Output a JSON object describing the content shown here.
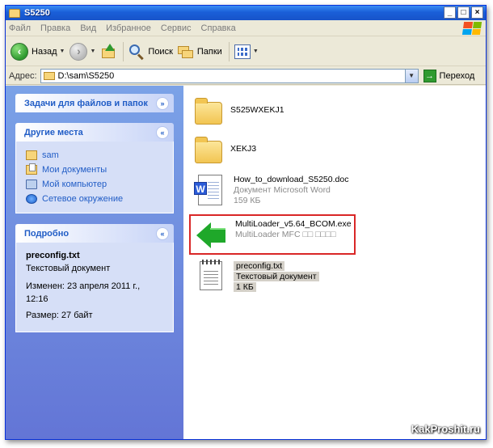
{
  "window": {
    "title": "S5250"
  },
  "menu": [
    "Файл",
    "Правка",
    "Вид",
    "Избранное",
    "Сервис",
    "Справка"
  ],
  "toolbar": {
    "back_label": "Назад",
    "search_label": "Поиск",
    "folders_label": "Папки"
  },
  "address": {
    "label": "Адрес:",
    "path": "D:\\sam\\S5250",
    "go_label": "Переход"
  },
  "tasks": {
    "file_tasks_title": "Задачи для файлов и папок",
    "other_places_title": "Другие места",
    "other_places": [
      {
        "label": "sam",
        "icon": "folder-icon"
      },
      {
        "label": "Мои документы",
        "icon": "my-documents-icon"
      },
      {
        "label": "Мой компьютер",
        "icon": "my-computer-icon"
      },
      {
        "label": "Сетевое окружение",
        "icon": "network-icon"
      }
    ],
    "details_title": "Подробно",
    "details": {
      "name": "preconfig.txt",
      "type": "Текстовый документ",
      "modified": "Изменен: 23 апреля 2011 г., 12:16",
      "size": "Размер: 27 байт"
    }
  },
  "files": [
    {
      "name": "S525WXEKJ1",
      "icon": "folder-icon"
    },
    {
      "name": "XEKJ3",
      "icon": "folder-icon"
    },
    {
      "name": "How_to_download_S5250.doc",
      "type": "Документ Microsoft Word",
      "size": "159 КБ",
      "icon": "word-document-icon"
    },
    {
      "name": "MultiLoader_v5.64_BCOM.exe",
      "type": "MultiLoader MFC □□ □□□□",
      "icon": "green-arrow-icon"
    },
    {
      "name": "preconfig.txt",
      "type": "Текстовый документ",
      "size": "1 КБ",
      "icon": "text-file-icon"
    }
  ],
  "watermark": "KakProshit.ru",
  "colors": {
    "titlebar": "#1A5FD8",
    "highlight_box": "#D92727",
    "task_link": "#215DC6"
  }
}
